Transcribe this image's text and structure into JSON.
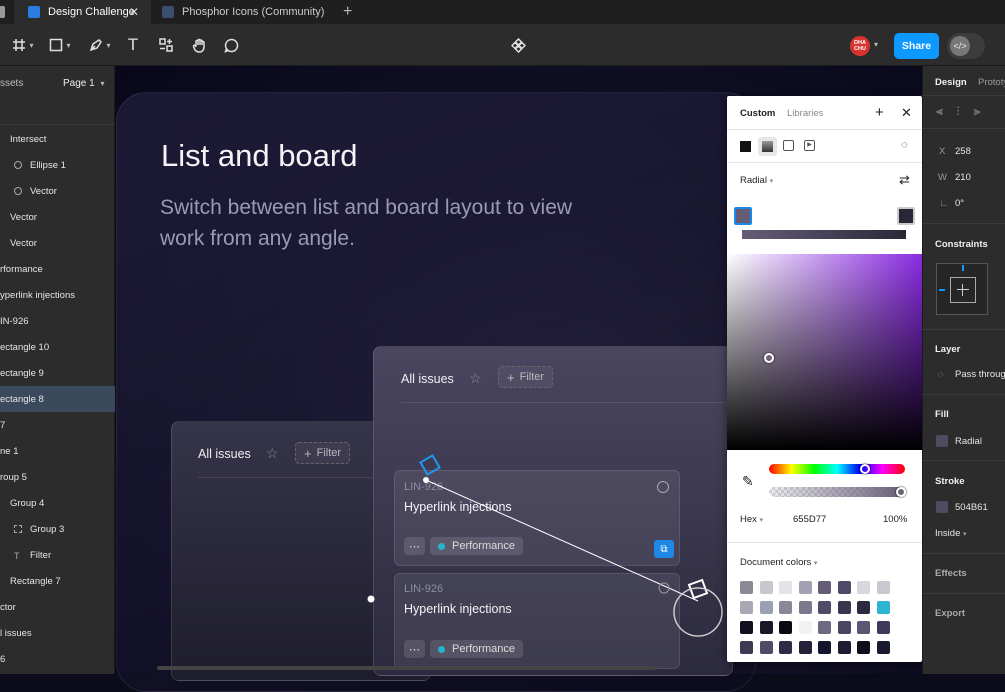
{
  "tabs": [
    {
      "label": "Design Challenge",
      "active": true
    },
    {
      "label": "Phosphor Icons (Community)",
      "active": false
    }
  ],
  "toolbar": {
    "avatar_text": "DHA CHU",
    "share_label": "Share",
    "devmode_icon": "</>"
  },
  "left_panel": {
    "assets_label": "ssets",
    "page_label": "Page 1",
    "layers": [
      "Intersect",
      "Ellipse 1",
      "Vector",
      "Vector",
      "Vector",
      "rformance",
      "yperlink injections",
      "IN-926",
      "ectangle 10",
      "ectangle 9",
      "ectangle 8",
      "7",
      "ne 1",
      "roup 5",
      "Group 4",
      "Group 3",
      "Filter",
      "Rectangle 7",
      "ctor",
      "l issues",
      "6"
    ]
  },
  "canvas": {
    "title": "List and board",
    "subtitle": "Switch between list and board layout to view work from any angle.",
    "back_card": {
      "title": "All issues",
      "filter": "Filter"
    },
    "front_card": {
      "title": "All issues",
      "filter": "Filter"
    },
    "issues": [
      {
        "id": "LIN-926",
        "title": "Hyperlink injections",
        "tag": "Performance",
        "more": "⋯"
      },
      {
        "id": "LIN-926",
        "title": "Hyperlink injections",
        "tag": "Performance",
        "more": "⋯"
      }
    ]
  },
  "picker": {
    "tab_custom": "Custom",
    "tab_libraries": "Libraries",
    "gradient_type": "Radial",
    "hex_mode": "Hex",
    "hex_value": "655D77",
    "opacity": "100%",
    "doc_colors_label": "Document colors",
    "hue_position": 0.71,
    "alpha_position": 1.0,
    "swatches": [
      "#8a8a96",
      "#c7c7cf",
      "#e4e4e8",
      "#a3a0b4",
      "#655d77",
      "#4f4a68",
      "#d7d7dc",
      "#c8c8d0",
      "#a8a8b4",
      "#9aa0b4",
      "#888899",
      "#7a7a8c",
      "#504b68",
      "#3a3650",
      "#2c2a40",
      "#2bb5d0",
      "#101020",
      "#181828",
      "#0a0a14",
      "#f2f2f4",
      "#6e6a84",
      "#4a4560",
      "#5a5674",
      "#3e3a58",
      "#3c3a52",
      "#504a66",
      "#2e2c44",
      "#242238",
      "#14142a",
      "#1e1c30",
      "#0e0e1c",
      "#1a1a2e"
    ]
  },
  "right_panel": {
    "tab_design": "Design",
    "tab_prototype": "Prototy",
    "x_label": "X",
    "x_value": "258",
    "w_label": "W",
    "w_value": "210",
    "rotation_value": "0°",
    "constraints_label": "Constraints",
    "layer_label": "Layer",
    "blend_mode": "Pass through",
    "fill_label": "Fill",
    "fill_type": "Radial",
    "stroke_label": "Stroke",
    "stroke_value": "504B61",
    "stroke_position": "Inside",
    "effects_label": "Effects",
    "export_label": "Export"
  },
  "colors": {
    "accent": "#0d99ff",
    "stroke": "#504B61",
    "fill_swatch": "#655D77",
    "tag_dot": "#26b5ce"
  }
}
